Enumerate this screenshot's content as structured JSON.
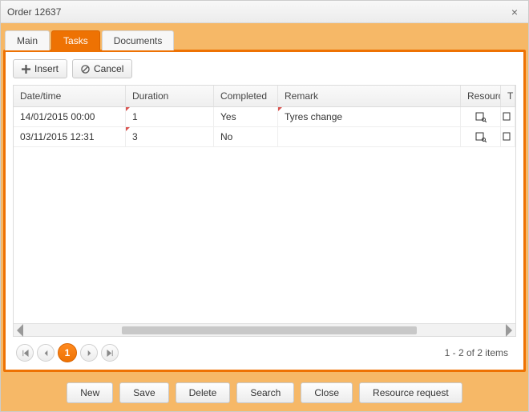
{
  "window": {
    "title": "Order 12637"
  },
  "tabs": [
    {
      "label": "Main"
    },
    {
      "label": "Tasks"
    },
    {
      "label": "Documents"
    }
  ],
  "active_tab": 1,
  "toolbar": {
    "insert_label": "Insert",
    "cancel_label": "Cancel"
  },
  "grid": {
    "columns": {
      "datetime": "Date/time",
      "duration": "Duration",
      "completed": "Completed",
      "remark": "Remark",
      "resources": "Resources",
      "tail": "T"
    },
    "rows": [
      {
        "datetime": "14/01/2015 00:00",
        "duration": "1",
        "completed": "Yes",
        "remark": "Tyres change",
        "dirty_duration": true,
        "dirty_remark": true
      },
      {
        "datetime": "03/11/2015 12:31",
        "duration": "3",
        "completed": "No",
        "remark": "",
        "dirty_duration": true,
        "dirty_remark": false
      }
    ]
  },
  "pager": {
    "page": "1",
    "info": "1 - 2 of 2 items"
  },
  "footer": {
    "new": "New",
    "save": "Save",
    "delete": "Delete",
    "search": "Search",
    "close": "Close",
    "resource_request": "Resource request"
  }
}
